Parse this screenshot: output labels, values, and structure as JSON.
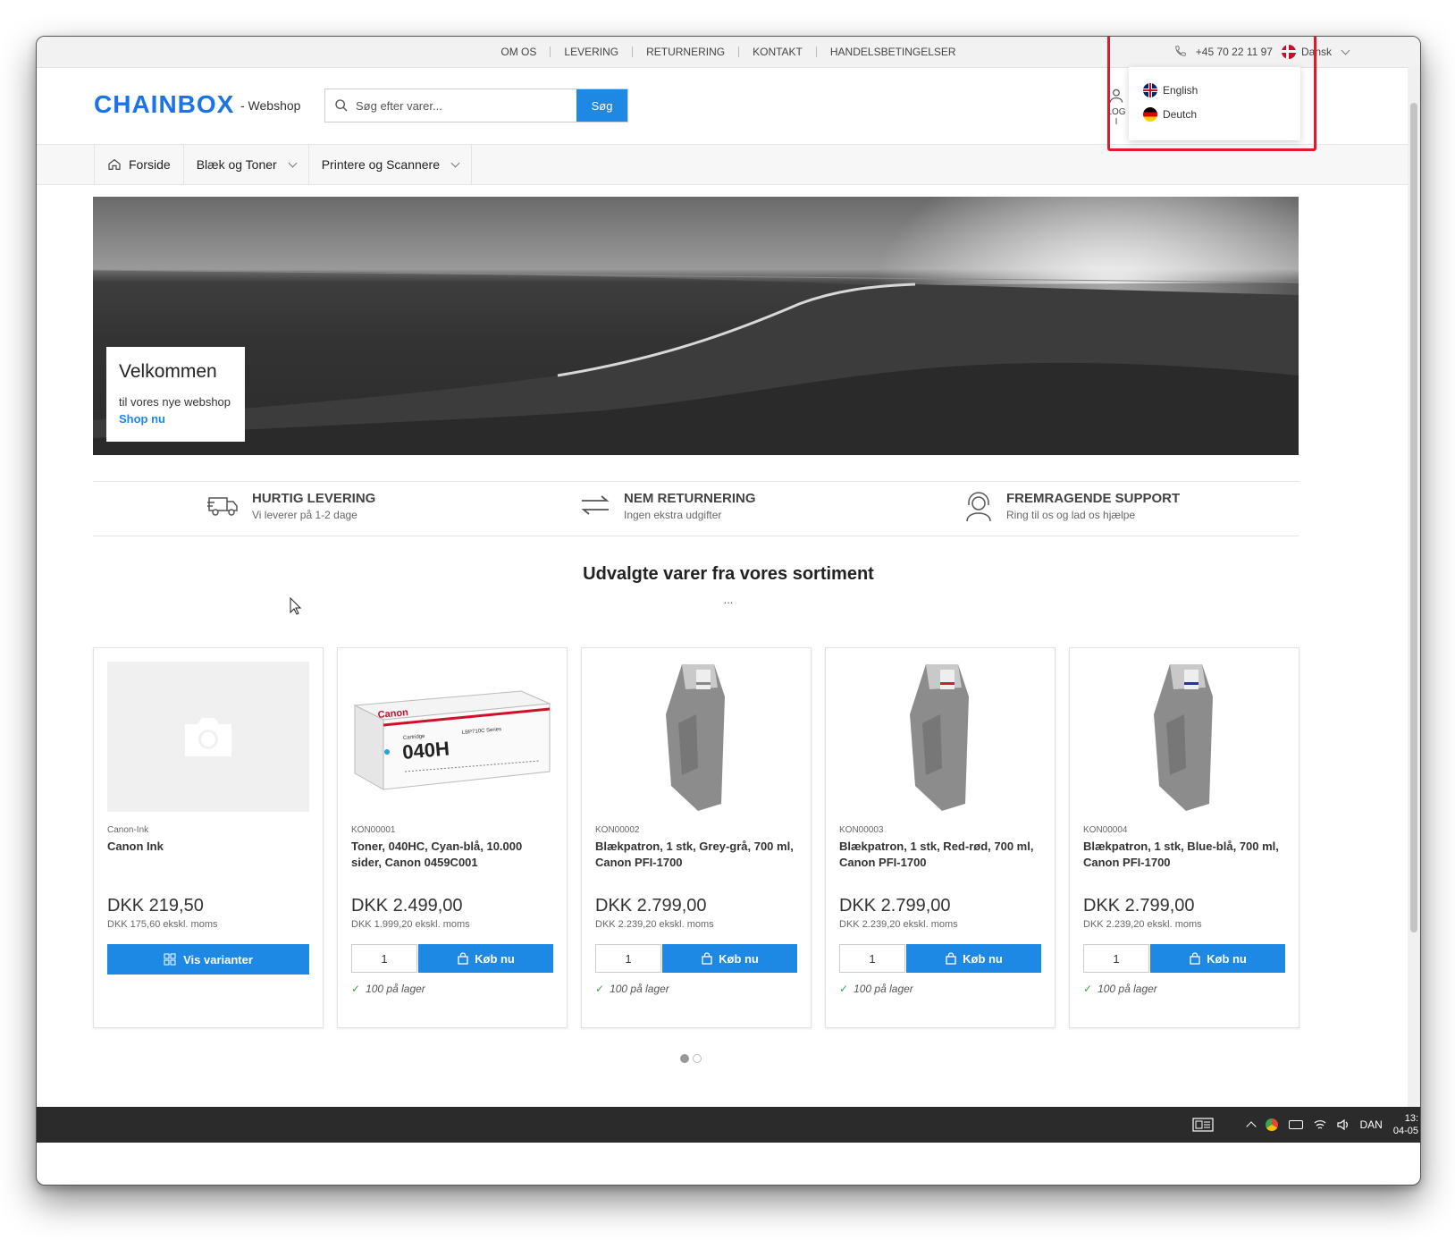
{
  "topbar": {
    "links": [
      "OM OS",
      "LEVERING",
      "RETURNERING",
      "KONTAKT",
      "HANDELSBETINGELSER"
    ],
    "phone": "+45 70 22 11 97",
    "language": "Dansk"
  },
  "language_dropdown": {
    "options": [
      "English",
      "Deutch"
    ]
  },
  "header": {
    "logo": "CHAINBOX",
    "logo_sub": "- Webshop",
    "search_placeholder": "Søg efter varer...",
    "search_button": "Søg",
    "login_label": "LOG I"
  },
  "nav": {
    "items": [
      "Forside",
      "Blæk og Toner",
      "Printere og Scannere"
    ]
  },
  "hero": {
    "title": "Velkommen",
    "subtitle": "til vores nye webshop",
    "cta": "Shop nu"
  },
  "features": [
    {
      "title": "HURTIG LEVERING",
      "subtitle": "Vi leverer på 1-2 dage",
      "icon": "truck-icon"
    },
    {
      "title": "NEM RETURNERING",
      "subtitle": "Ingen ekstra udgifter",
      "icon": "exchange-arrows-icon"
    },
    {
      "title": "FREMRAGENDE SUPPORT",
      "subtitle": "Ring til os og lad os hjælpe",
      "icon": "headset-icon"
    }
  ],
  "section": {
    "title": "Udvalgte varer fra vores sortiment",
    "dots": "..."
  },
  "products": [
    {
      "sku": "Canon-Ink",
      "name": "Canon Ink",
      "price": "DKK 219,50",
      "ex_moms": "DKK 175,60 ekskl. moms",
      "button": "Vis varianter",
      "image": "placeholder-camera"
    },
    {
      "sku": "KON00001",
      "name": "Toner, 040HC, Cyan-blå, 10.000 sider, Canon 0459C001",
      "price": "DKK 2.499,00",
      "ex_moms": "DKK 1.999,20 ekskl. moms",
      "qty": "1",
      "button": "Køb nu",
      "stock": "100 på lager",
      "image": "toner-box"
    },
    {
      "sku": "KON00002",
      "name": "Blækpatron, 1 stk, Grey-grå, 700 ml, Canon PFI-1700",
      "price": "DKK 2.799,00",
      "ex_moms": "DKK 2.239,20 ekskl. moms",
      "qty": "1",
      "button": "Køb nu",
      "stock": "100 på lager",
      "image": "ink-cartridge",
      "accent": "#888888"
    },
    {
      "sku": "KON00003",
      "name": "Blækpatron, 1 stk, Red-rød, 700 ml, Canon PFI-1700",
      "price": "DKK 2.799,00",
      "ex_moms": "DKK 2.239,20 ekskl. moms",
      "qty": "1",
      "button": "Køb nu",
      "stock": "100 på lager",
      "image": "ink-cartridge",
      "accent": "#cc2222"
    },
    {
      "sku": "KON00004",
      "name": "Blækpatron, 1 stk, Blue-blå, 700 ml, Canon PFI-1700",
      "price": "DKK 2.799,00",
      "ex_moms": "DKK 2.239,20 ekskl. moms",
      "qty": "1",
      "button": "Køb nu",
      "stock": "100 på lager",
      "image": "ink-cartridge",
      "accent": "#2233aa"
    }
  ],
  "toner_box": {
    "brand": "Canon",
    "model": "040H",
    "cartridge": "Cartridge",
    "series": "LBP710C Series"
  },
  "taskbar": {
    "language": "DAN",
    "time": "13:",
    "date": "04-05"
  },
  "colors": {
    "accent": "#1e88e5",
    "highlight": "#e11a2b"
  }
}
